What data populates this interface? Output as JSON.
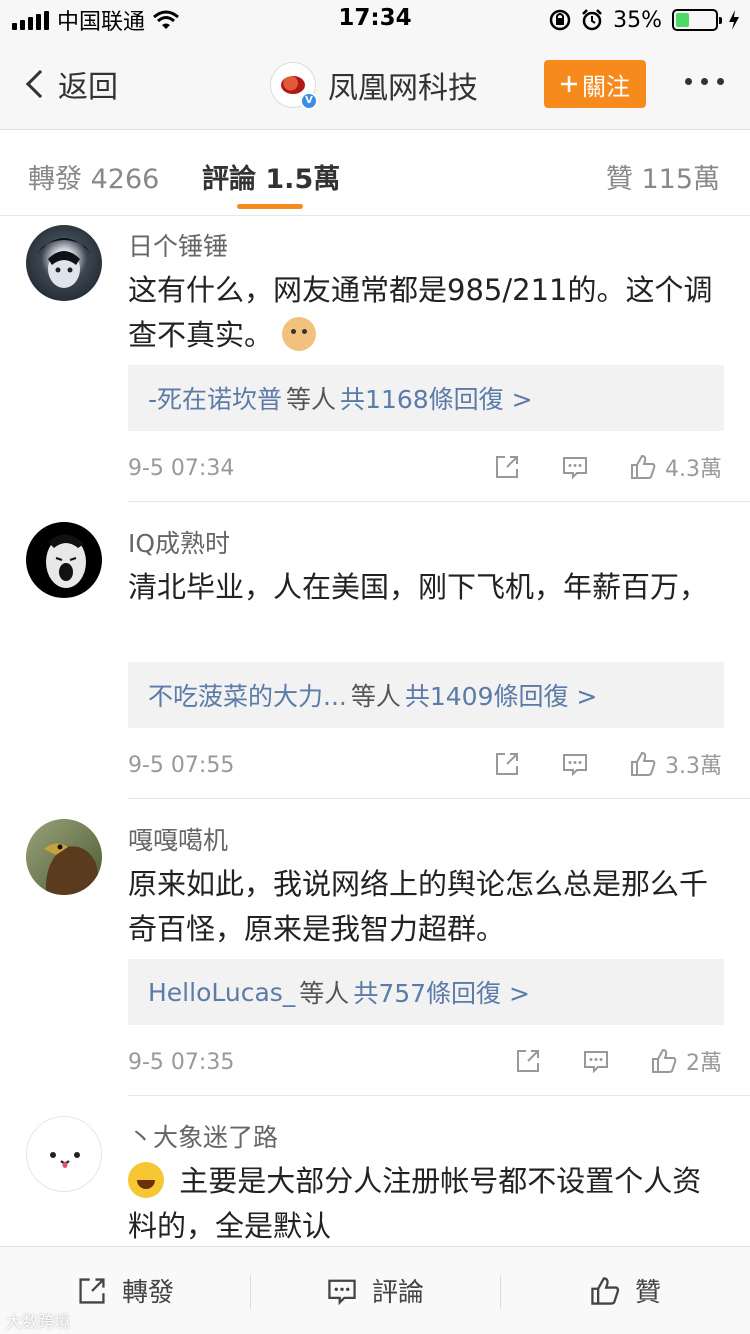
{
  "status_bar": {
    "carrier": "中国联通",
    "time": "17:34",
    "battery_percent": "35%",
    "battery_level": 0.35,
    "icons": [
      "signal-icon",
      "wifi-icon",
      "orientation-lock-icon",
      "alarm-icon",
      "battery-icon",
      "charging-icon"
    ]
  },
  "nav": {
    "back_label": "返回",
    "title": "凤凰网科技",
    "follow_label": "關注"
  },
  "tabs": {
    "repost": "轉發 4266",
    "comments": "評論 1.5萬",
    "likes": "贊 115萬"
  },
  "comments": [
    {
      "user": "日个锤锤",
      "text": "这有什么，网友通常都是985/211的。这个调查不真实。",
      "emoji": "doge-emoji-icon",
      "reply_user": "-死在诺坎普",
      "reply_mid": "等人",
      "reply_count": "共1168條回復 >",
      "time": "9-5 07:34",
      "likes": "4.3萬"
    },
    {
      "user": "IQ成熟时",
      "text": "清北毕业，人在美国，刚下飞机，年薪百万，",
      "reply_user": "不吃菠菜的大力...",
      "reply_mid": "等人",
      "reply_count": "共1409條回復 >",
      "time": "9-5 07:55",
      "likes": "3.3萬"
    },
    {
      "user": "嘎嘎噶机",
      "text": "原来如此，我说网络上的舆论怎么总是那么千奇百怪，原来是我智力超群。",
      "reply_user": "HelloLucas_",
      "reply_mid": "等人",
      "reply_count": "共757條回復 >",
      "time": "9-5 07:35",
      "likes": "2萬"
    },
    {
      "user": "丶大象迷了路",
      "text": "主要是大部分人注册帐号都不设置个人资料的，全是默认",
      "emoji": "laughing-crying-emoji-icon"
    }
  ],
  "toolbar": {
    "repost": "轉發",
    "comment": "評論",
    "like": "贊"
  },
  "watermark": "大数跨境",
  "colors": {
    "accent": "#f78a1d",
    "link": "#5b7ba8",
    "verified": "#3a8ee6",
    "battery": "#4cd964"
  }
}
